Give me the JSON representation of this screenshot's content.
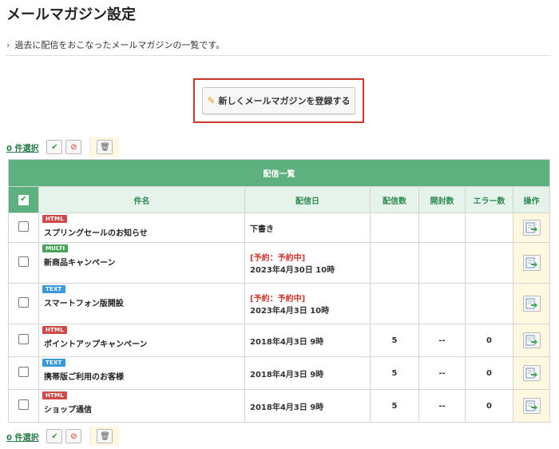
{
  "page": {
    "title": "メールマガジン設定",
    "description": "過去に配信をおこなったメールマガジンの一覧です。",
    "add_button_label": "新しくメールマガジンを登録する"
  },
  "bulk": {
    "selected_count_label": "0 件選択"
  },
  "table": {
    "caption": "配信一覧",
    "headers": {
      "subject": "件名",
      "date": "配信日",
      "sent": "配信数",
      "opened": "開封数",
      "errors": "エラー数",
      "actions": "操作"
    },
    "rows": [
      {
        "type": "HTML",
        "subject": "スプリングセールのお知らせ",
        "status": "",
        "date": "下書き",
        "sent": "",
        "opened": "",
        "errors": ""
      },
      {
        "type": "MULTI",
        "subject": "新商品キャンペーン",
        "status": "[予約：予約中]",
        "date": "2023年4月30日 10時",
        "sent": "",
        "opened": "",
        "errors": ""
      },
      {
        "type": "TEXT",
        "subject": "スマートフォン版開設",
        "status": "[予約：予約中]",
        "date": "2023年4月3日 10時",
        "sent": "",
        "opened": "",
        "errors": ""
      },
      {
        "type": "HTML",
        "subject": "ポイントアップキャンペーン",
        "status": "",
        "date": "2018年4月3日 9時",
        "sent": "5",
        "opened": "--",
        "errors": "0"
      },
      {
        "type": "TEXT",
        "subject": "携帯版ご利用のお客様",
        "status": "",
        "date": "2018年4月3日 9時",
        "sent": "5",
        "opened": "--",
        "errors": "0"
      },
      {
        "type": "HTML",
        "subject": "ショップ通信",
        "status": "",
        "date": "2018年4月3日 9時",
        "sent": "5",
        "opened": "--",
        "errors": "0"
      }
    ]
  },
  "icons": {
    "add": "pencil-icon",
    "select_all": "check-icon",
    "deselect": "ban-icon",
    "delete": "trash-icon",
    "row_action": "export-arrow-icon"
  },
  "colors": {
    "header_green": "#5fb07f",
    "header_light": "#e6f3ea",
    "badge_html": "#cf4a4a",
    "badge_multi": "#4aa35a",
    "badge_text": "#3a9ad9",
    "reserve_red": "#d0342c",
    "highlight_border": "#d0342c"
  }
}
